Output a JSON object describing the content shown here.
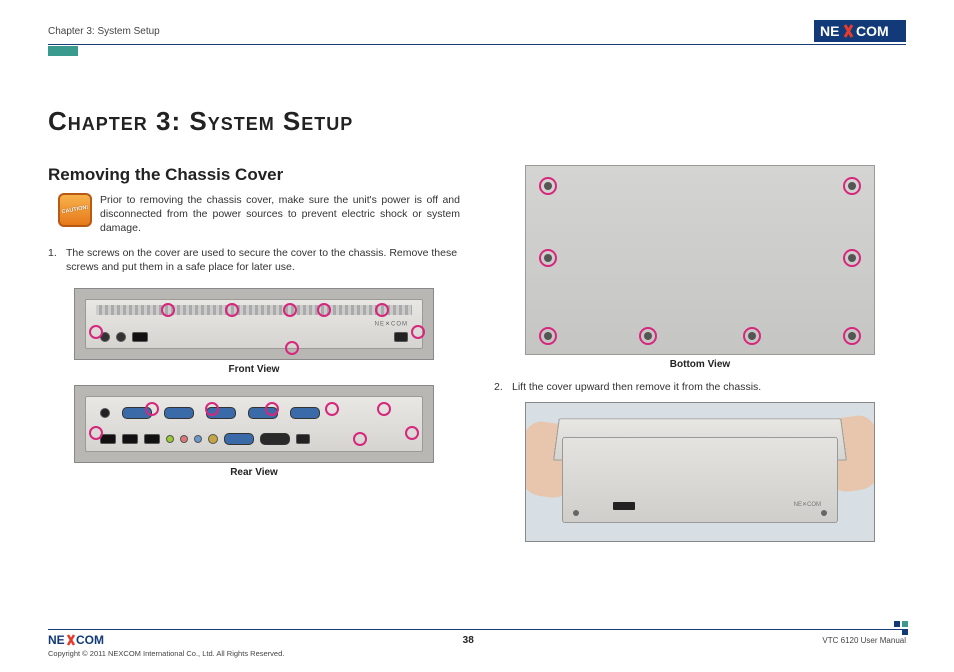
{
  "header": {
    "chapter_label": "Chapter 3: System Setup",
    "logo_text_left": "NE",
    "logo_text_right": "COM"
  },
  "title": "Chapter 3: System Setup",
  "section": {
    "heading": "Removing the Chassis Cover",
    "caution_text": "Prior to removing the chassis cover, make sure the unit's power is off and disconnected from the power sources to prevent electric shock or system damage.",
    "step1_num": "1.",
    "step1_text": "The screws on the cover are used to secure the cover to the chassis. Remove these screws and put them in a safe place for later use.",
    "step2_num": "2.",
    "step2_text": "Lift the cover upward then remove it from the chassis."
  },
  "captions": {
    "front": "Front View",
    "rear": "Rear View",
    "bottom": "Bottom View"
  },
  "footer": {
    "page_number": "38",
    "manual_name": "VTC 6120 User Manual",
    "copyright": "Copyright © 2011 NEXCOM International Co., Ltd. All Rights Reserved."
  }
}
